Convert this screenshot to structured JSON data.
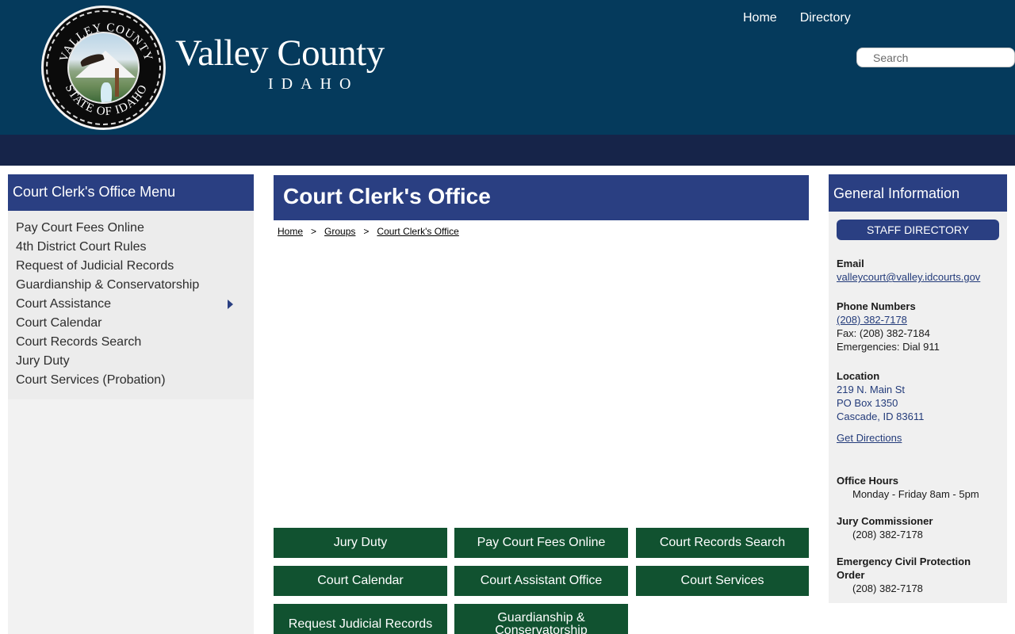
{
  "header": {
    "title": "Valley County",
    "subtitle": "IDAHO",
    "seal_text_top": "VALLEY COUNTY",
    "seal_text_bottom": "STATE OF IDAHO",
    "nav": [
      {
        "label": "Home"
      },
      {
        "label": "Directory"
      }
    ],
    "search_placeholder": "Search"
  },
  "left_sidebar": {
    "title": "Court Clerk's Office Menu",
    "items": [
      {
        "label": "Pay Court Fees Online"
      },
      {
        "label": "4th District Court Rules"
      },
      {
        "label": "Request of Judicial Records"
      },
      {
        "label": "Guardianship & Conservatorship"
      },
      {
        "label": "Court Assistance",
        "has_submenu": true
      },
      {
        "label": "Court Calendar"
      },
      {
        "label": "Court Records Search"
      },
      {
        "label": "Jury Duty"
      },
      {
        "label": "Court Services (Probation)"
      }
    ]
  },
  "main": {
    "title": "Court Clerk's Office",
    "breadcrumb": [
      "Home",
      "Groups",
      "Court Clerk's Office"
    ],
    "breadcrumb_sep": ">",
    "buttons": [
      {
        "label": "Jury Duty"
      },
      {
        "label": "Pay Court Fees Online"
      },
      {
        "label": "Court Records Search"
      },
      {
        "label": "Court Calendar"
      },
      {
        "label": "Court Assistant Office"
      },
      {
        "label": "Court Services"
      },
      {
        "label": "Request Judicial Records"
      },
      {
        "label": "Guardianship & Conservatorship"
      }
    ]
  },
  "right_sidebar": {
    "title": "General Information",
    "staff_button": "STAFF DIRECTORY",
    "email_label": "Email",
    "email": "valleycourt@valley.idcourts.gov",
    "phone_label": "Phone Numbers",
    "phone": "(208) 382-7178",
    "fax": "Fax: (208) 382-7184",
    "emergencies": "Emergencies: Dial 911",
    "location_label": "Location",
    "address_line1": "219 N. Main St",
    "address_line2": "PO Box 1350",
    "address_line3": "Cascade, ID 83611",
    "directions": "Get Directions",
    "hours_label": "Office Hours",
    "hours": "Monday - Friday 8am - 5pm",
    "jury_label": "Jury Commissioner",
    "jury_phone": "(208) 382-7178",
    "ecpo_label": "Emergency Civil Protection Order",
    "ecpo_phone": "(208) 382-7178"
  },
  "colors": {
    "header_bg": "#053a5c",
    "nav_strip": "#162449",
    "panel_blue": "#2a3f82",
    "button_green": "#115230"
  }
}
